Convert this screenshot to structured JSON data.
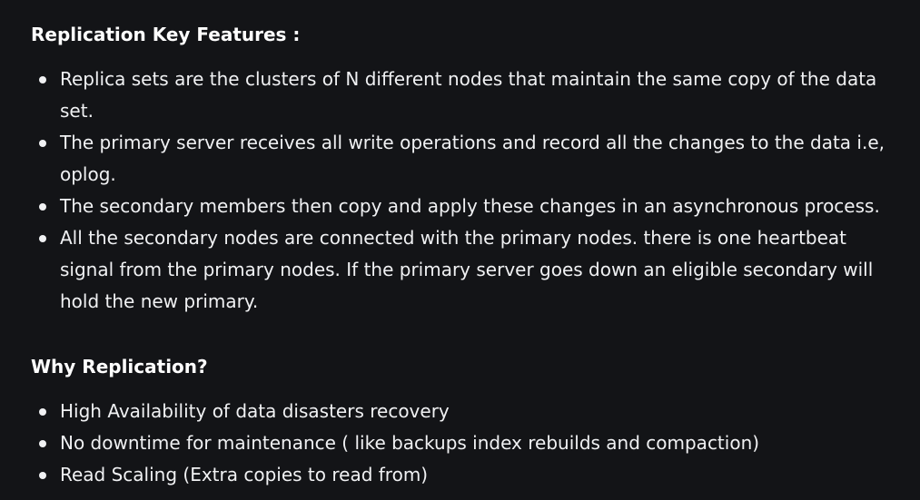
{
  "section1": {
    "title": "Replication Key Features :",
    "items": [
      "Replica sets are the clusters of N different nodes that maintain the same copy of the data set.",
      "The primary server receives all write operations and record all the changes to the data i.e, oplog.",
      "The secondary members then copy and apply these changes in an asynchronous process.",
      "All the secondary nodes are connected with the primary nodes. there is one heartbeat signal from the primary nodes. If the primary server goes down an eligible secondary will hold the new primary."
    ]
  },
  "section2": {
    "title": "Why Replication?",
    "items": [
      "High Availability of data disasters recovery",
      "No downtime for maintenance ( like backups index rebuilds and compaction)",
      "Read Scaling (Extra copies to read from)"
    ]
  }
}
